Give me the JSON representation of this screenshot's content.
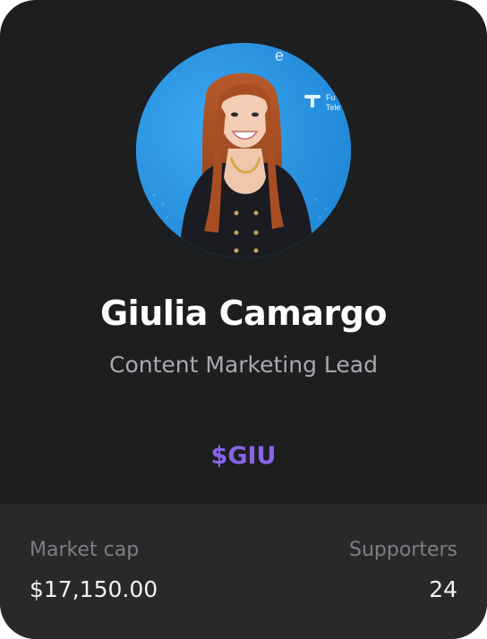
{
  "profile": {
    "name": "Giulia Camargo",
    "role": "Content Marketing Lead",
    "ticker": "$GIU"
  },
  "stats": {
    "market_cap_label": "Market cap",
    "market_cap_value": "$17,150.00",
    "supporters_label": "Supporters",
    "supporters_value": "24"
  },
  "colors": {
    "card_bg": "#1d1e20",
    "footer_bg": "#29292c",
    "accent": "#8a63e8",
    "avatar_bg": "#2f98e6"
  }
}
